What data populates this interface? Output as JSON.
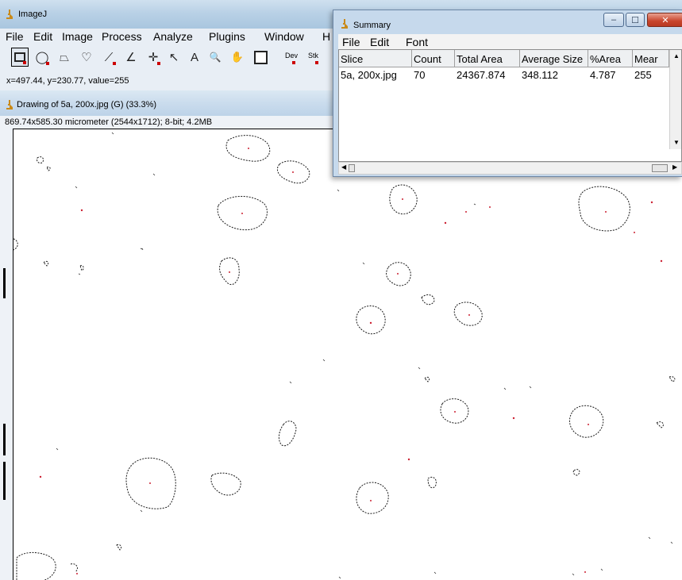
{
  "main_window": {
    "title": "ImageJ",
    "menu": [
      "File",
      "Edit",
      "Image",
      "Process",
      "Analyze",
      "Plugins",
      "Window",
      "H"
    ],
    "tools": [
      {
        "name": "rectangle-tool-icon",
        "glyph": "▭"
      },
      {
        "name": "oval-tool-icon",
        "glyph": "◯"
      },
      {
        "name": "polygon-tool-icon",
        "glyph": "⏢"
      },
      {
        "name": "freehand-tool-icon",
        "glyph": "♡"
      },
      {
        "name": "line-tool-icon",
        "glyph": "⟋"
      },
      {
        "name": "angle-tool-icon",
        "glyph": "∠"
      },
      {
        "name": "point-tool-icon",
        "glyph": "✛"
      },
      {
        "name": "wand-tool-icon",
        "glyph": "↖"
      },
      {
        "name": "text-tool-icon",
        "glyph": "A"
      },
      {
        "name": "magnifier-tool-icon",
        "glyph": "🔍"
      },
      {
        "name": "hand-tool-icon",
        "glyph": "✋"
      },
      {
        "name": "color-picker-tool-icon",
        "glyph": "☐"
      }
    ],
    "dev_label": "Dev",
    "stk_label": "Stk",
    "status": "x=497.44, y=230.77, value=255"
  },
  "image_window": {
    "title": "Drawing of 5a, 200x.jpg (G) (33.3%)",
    "info": "869.74x585.30 micrometer (2544x1712); 8-bit; 4.2MB"
  },
  "summary_window": {
    "title": "Summary",
    "menu": [
      "File",
      "Edit",
      "Font"
    ],
    "columns": [
      "Slice",
      "Count",
      "Total Area",
      "Average Size",
      "%Area",
      "Mear"
    ],
    "rows": [
      [
        "5a, 200x.jpg",
        "70",
        "24367.874",
        "348.112",
        "4.787",
        "255"
      ]
    ]
  },
  "colors": {
    "outline": "#1a1a1a",
    "centroid": "#cc2233",
    "title_gradient": "#b9d1e6"
  }
}
